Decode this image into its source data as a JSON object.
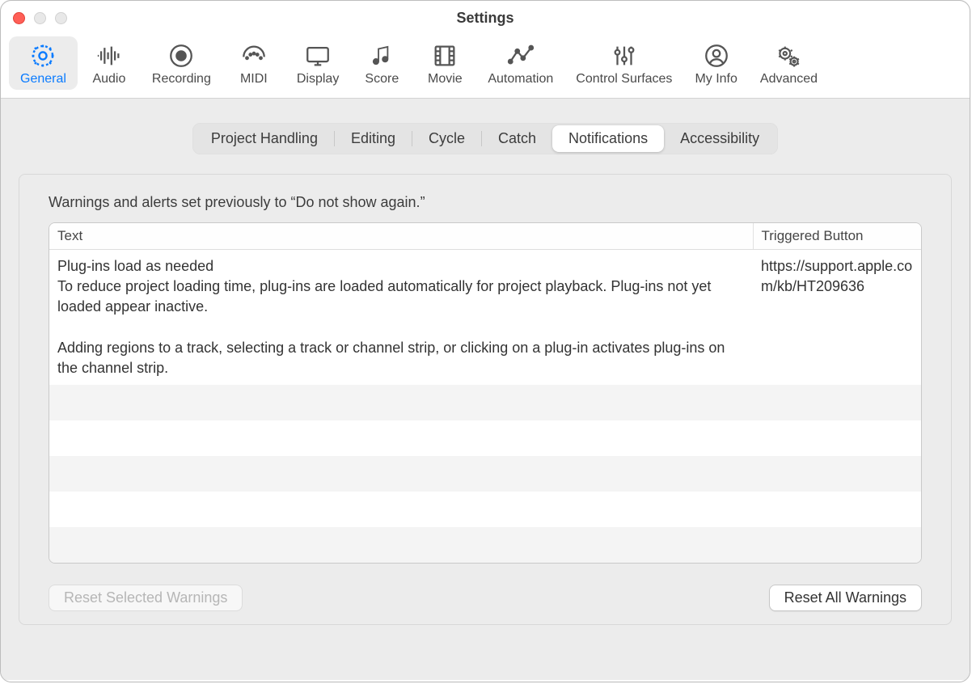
{
  "window": {
    "title": "Settings"
  },
  "toolbar": {
    "items": [
      {
        "id": "general",
        "label": "General",
        "active": true
      },
      {
        "id": "audio",
        "label": "Audio"
      },
      {
        "id": "recording",
        "label": "Recording"
      },
      {
        "id": "midi",
        "label": "MIDI"
      },
      {
        "id": "display",
        "label": "Display"
      },
      {
        "id": "score",
        "label": "Score"
      },
      {
        "id": "movie",
        "label": "Movie"
      },
      {
        "id": "automation",
        "label": "Automation"
      },
      {
        "id": "control-surfaces",
        "label": "Control Surfaces"
      },
      {
        "id": "my-info",
        "label": "My Info"
      },
      {
        "id": "advanced",
        "label": "Advanced"
      }
    ]
  },
  "subtabs": {
    "items": [
      {
        "id": "project-handling",
        "label": "Project Handling"
      },
      {
        "id": "editing",
        "label": "Editing"
      },
      {
        "id": "cycle",
        "label": "Cycle"
      },
      {
        "id": "catch",
        "label": "Catch"
      },
      {
        "id": "notifications",
        "label": "Notifications",
        "active": true
      },
      {
        "id": "accessibility",
        "label": "Accessibility"
      }
    ]
  },
  "notifications": {
    "description": "Warnings and alerts set previously to “Do not show again.”",
    "columns": {
      "text": "Text",
      "triggered": "Triggered Button"
    },
    "rows": [
      {
        "text": "Plug-ins load as needed\nTo reduce project loading time, plug-ins are loaded automatically for project playback. Plug-ins not yet loaded appear inactive.\n\nAdding regions to a track, selecting a track or channel strip, or clicking on a plug-in activates plug-ins on the channel strip.",
        "triggered": "https://support.apple.com/kb/HT209636"
      }
    ],
    "buttons": {
      "reset_selected": "Reset Selected Warnings",
      "reset_all": "Reset All Warnings"
    }
  }
}
